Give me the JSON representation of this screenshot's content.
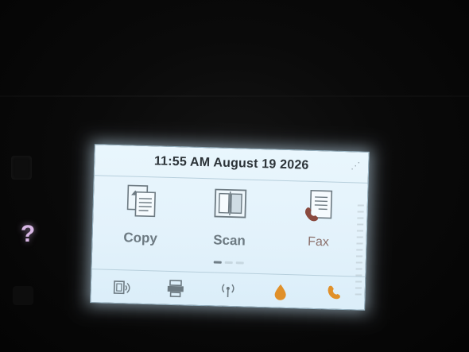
{
  "device": {
    "help_symbol": "?"
  },
  "screen": {
    "datetime": "11:55 AM August 19 2026",
    "tiles": [
      {
        "label": "Copy",
        "icon": "copy-icon"
      },
      {
        "label": "Scan",
        "icon": "scan-icon"
      },
      {
        "label": "Fax",
        "icon": "fax-icon"
      }
    ],
    "page_indicator": {
      "pages": 3,
      "active": 1
    },
    "status_icons": [
      "wifi-direct-icon",
      "eprint-icon",
      "wireless-icon",
      "ink-icon",
      "fax-status-icon"
    ]
  },
  "colors": {
    "screen_bg": "#e3f2fb",
    "text_dark": "#2c3338",
    "icon_gray": "#6d7a82",
    "ink_orange": "#e0902a",
    "help_pink": "#d9b8e6"
  }
}
